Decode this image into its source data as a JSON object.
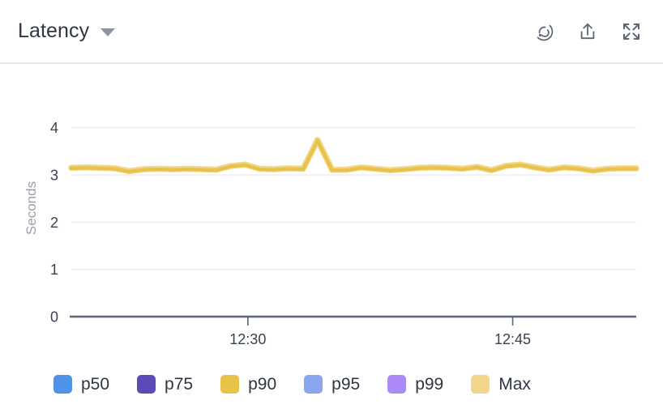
{
  "header": {
    "title": "Latency",
    "caret_icon": "chevron-down-icon",
    "actions": [
      {
        "name": "live-data-icon",
        "label": "Live data"
      },
      {
        "name": "share-icon",
        "label": "Share"
      },
      {
        "name": "fullscreen-icon",
        "label": "Fullscreen"
      }
    ]
  },
  "chart_data": {
    "type": "line",
    "title": "Latency",
    "xlabel": "",
    "ylabel": "Seconds",
    "ylim": [
      0,
      4.2
    ],
    "yticks": [
      0,
      1,
      2,
      3,
      4
    ],
    "ytick_labels": [
      "0",
      "1",
      "2",
      "3",
      "4"
    ],
    "xtick_labels": [
      "12:30",
      "12:45"
    ],
    "xtick_positions": [
      0.3125,
      0.78125
    ],
    "grid": true,
    "grid_axis": "y",
    "legend_position": "bottom",
    "x": [
      0.0,
      0.0256,
      0.0513,
      0.0769,
      0.1026,
      0.1282,
      0.1538,
      0.1795,
      0.2051,
      0.2308,
      0.2564,
      0.2821,
      0.3077,
      0.3333,
      0.359,
      0.3846,
      0.4103,
      0.4359,
      0.4615,
      0.4872,
      0.5128,
      0.5385,
      0.5641,
      0.5897,
      0.6154,
      0.641,
      0.6667,
      0.6923,
      0.7179,
      0.7436,
      0.7692,
      0.7949,
      0.8205,
      0.8462,
      0.8718,
      0.8974,
      0.9231,
      0.9487,
      0.9744,
      1.0
    ],
    "series": [
      {
        "name": "p50",
        "color": "#4f93e8",
        "visible": false,
        "values": []
      },
      {
        "name": "p75",
        "color": "#5b4bb8",
        "visible": false,
        "values": []
      },
      {
        "name": "p90",
        "color": "#e8c34a",
        "visible": true,
        "values": [
          3.14,
          3.15,
          3.14,
          3.13,
          3.07,
          3.11,
          3.12,
          3.11,
          3.12,
          3.11,
          3.1,
          3.18,
          3.21,
          3.12,
          3.11,
          3.13,
          3.12,
          3.73,
          3.1,
          3.1,
          3.15,
          3.12,
          3.09,
          3.11,
          3.14,
          3.15,
          3.14,
          3.12,
          3.16,
          3.09,
          3.18,
          3.21,
          3.15,
          3.1,
          3.15,
          3.13,
          3.08,
          3.12,
          3.13,
          3.13
        ]
      },
      {
        "name": "p95",
        "color": "#8aa6f0",
        "visible": false,
        "values": []
      },
      {
        "name": "p99",
        "color": "#ab8af5",
        "visible": false,
        "values": []
      },
      {
        "name": "Max",
        "color": "#f2d68c",
        "visible": true,
        "values": [
          3.15,
          3.16,
          3.15,
          3.14,
          3.08,
          3.12,
          3.13,
          3.12,
          3.13,
          3.12,
          3.11,
          3.19,
          3.22,
          3.13,
          3.12,
          3.14,
          3.13,
          3.74,
          3.11,
          3.11,
          3.16,
          3.13,
          3.1,
          3.12,
          3.15,
          3.16,
          3.15,
          3.13,
          3.17,
          3.1,
          3.19,
          3.22,
          3.16,
          3.11,
          3.16,
          3.14,
          3.09,
          3.13,
          3.14,
          3.14
        ]
      }
    ]
  },
  "legend": {
    "items": [
      {
        "label": "p50",
        "color": "#4f93e8"
      },
      {
        "label": "p75",
        "color": "#5b4bb8"
      },
      {
        "label": "p90",
        "color": "#e8c34a"
      },
      {
        "label": "p95",
        "color": "#8aa6f0"
      },
      {
        "label": "p99",
        "color": "#ab8af5"
      },
      {
        "label": "Max",
        "color": "#f2d68c"
      }
    ]
  }
}
